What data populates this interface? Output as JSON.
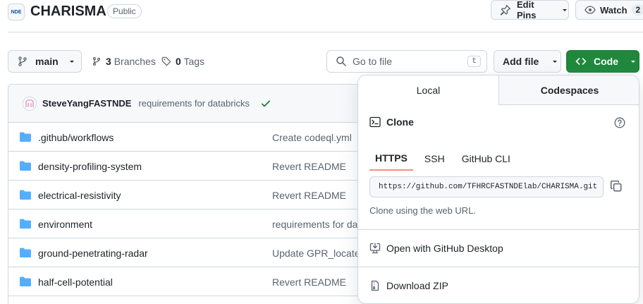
{
  "repo": {
    "logo_text": "NDE",
    "name": "CHARISMA",
    "visibility": "Public"
  },
  "header_actions": {
    "edit_pins_label": "Edit Pins",
    "watch_label": "Watch",
    "watch_count": "2"
  },
  "toolbar": {
    "branch": "main",
    "branches_count": "3",
    "branches_label": "Branches",
    "tags_count": "0",
    "tags_label": "Tags",
    "goto_placeholder": "Go to file",
    "goto_shortcut": "t",
    "add_file_label": "Add file",
    "code_label": "Code"
  },
  "latest_commit": {
    "author": "SteveYangFASTNDE",
    "message": "requirements for databricks"
  },
  "files": [
    {
      "name": ".github/workflows",
      "message": "Create codeql.yml"
    },
    {
      "name": "density-profiling-system",
      "message": "Revert README"
    },
    {
      "name": "electrical-resistivity",
      "message": "Revert README"
    },
    {
      "name": "environment",
      "message": "requirements for da"
    },
    {
      "name": "ground-penetrating-radar",
      "message": "Update GPR_locate_"
    },
    {
      "name": "half-cell-potential",
      "message": "Revert README"
    }
  ],
  "code_panel": {
    "tabs": [
      "Local",
      "Codespaces"
    ],
    "clone_title": "Clone",
    "protocols": [
      "HTTPS",
      "SSH",
      "GitHub CLI"
    ],
    "clone_url": "https://github.com/TFHRCFASTNDElab/CHARISMA.git",
    "clone_hint": "Clone using the web URL.",
    "open_desktop_label": "Open with GitHub Desktop",
    "download_zip_label": "Download ZIP"
  },
  "colors": {
    "accent_green": "#1f883d",
    "folder_blue": "#54aeff",
    "tab_underline": "#fd8c73"
  }
}
